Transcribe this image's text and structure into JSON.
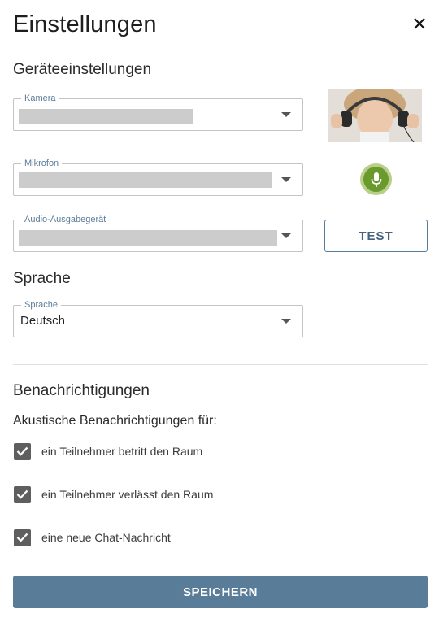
{
  "dialog": {
    "title": "Einstellungen",
    "close_icon": "close-icon"
  },
  "device_settings": {
    "heading": "Geräteeinstellungen",
    "camera": {
      "label": "Kamera",
      "value": ""
    },
    "microphone": {
      "label": "Mikrofon",
      "value": ""
    },
    "audio_output": {
      "label": "Audio-Ausgabegerät",
      "value": ""
    },
    "camera_preview": "camera-preview-image",
    "mic_icon": "microphone-icon",
    "test_label": "TEST"
  },
  "language": {
    "heading": "Sprache",
    "field_label": "Sprache",
    "value": "Deutsch"
  },
  "notifications": {
    "heading": "Benachrichtigungen",
    "subheading": "Akustische Benachrichtigungen für:",
    "options": [
      {
        "label": "ein Teilnehmer betritt den Raum",
        "checked": true
      },
      {
        "label": "ein Teilnehmer verlässt den Raum",
        "checked": true
      },
      {
        "label": "eine neue Chat-Nachricht",
        "checked": true
      }
    ]
  },
  "footer": {
    "save_label": "SPEICHERN"
  },
  "colors": {
    "accent": "#597d99",
    "mic_green": "#6a9a2e",
    "checkbox": "#5f5f5f"
  }
}
